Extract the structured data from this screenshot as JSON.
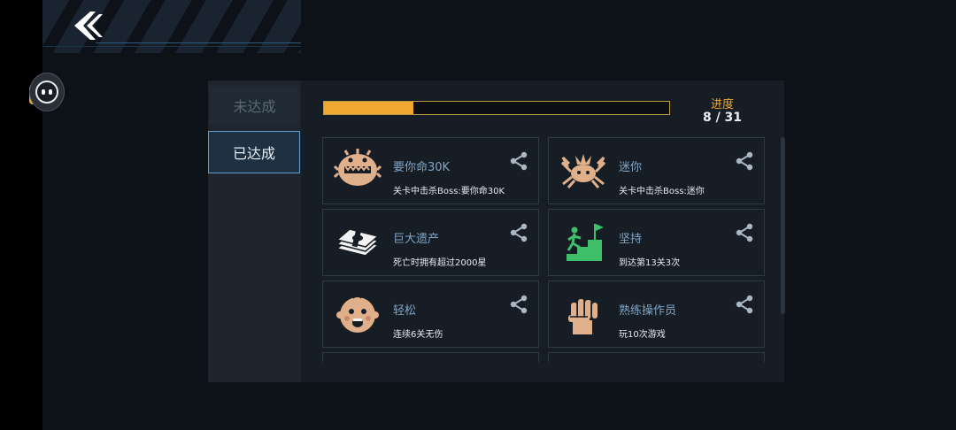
{
  "tabs": {
    "undone_label": "未达成",
    "done_label": "已达成",
    "active": "done"
  },
  "progress": {
    "title": "进度",
    "count_text": "8 / 31",
    "achieved": 8,
    "total": 31
  },
  "colors": {
    "accent": "#f0a830",
    "title_blue": "#7fa6c7",
    "icon_tan": "#e0b08a",
    "icon_green": "#3fbf6a"
  },
  "achievements": [
    {
      "title": "要你命30K",
      "desc": "关卡中击杀Boss:要你命30K",
      "icon": "boss-30k-icon"
    },
    {
      "title": "迷你",
      "desc": "关卡中击杀Boss:迷你",
      "icon": "boss-mini-crab-icon"
    },
    {
      "title": "巨大遗产",
      "desc": "死亡时拥有超过2000星",
      "icon": "money-stack-icon"
    },
    {
      "title": "坚持",
      "desc": "到达第13关3次",
      "icon": "climb-stairs-flag-icon"
    },
    {
      "title": "轻松",
      "desc": "连续6关无伤",
      "icon": "baby-face-icon"
    },
    {
      "title": "熟练操作员",
      "desc": "玩10次游戏",
      "icon": "raised-fist-icon"
    },
    {
      "title": "",
      "desc": "",
      "icon": ""
    },
    {
      "title": "",
      "desc": "",
      "icon": ""
    }
  ]
}
